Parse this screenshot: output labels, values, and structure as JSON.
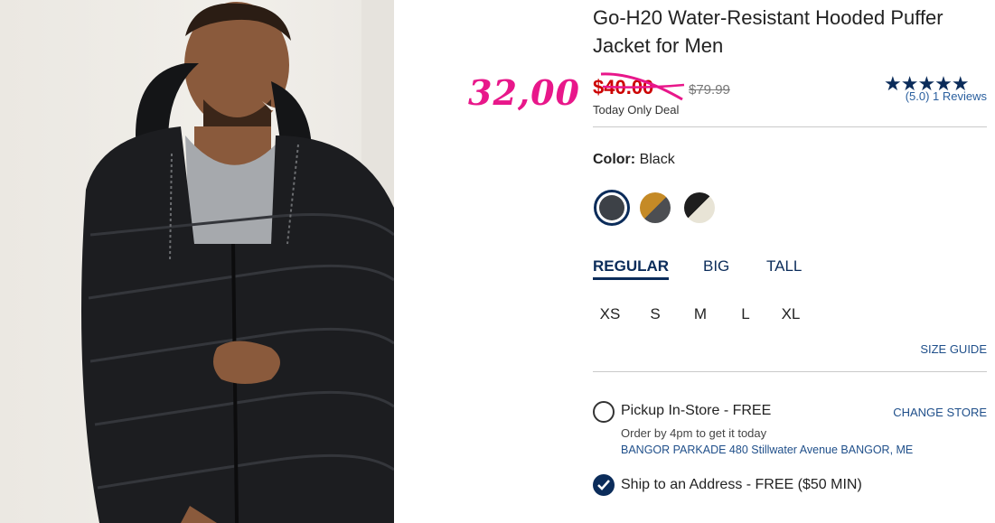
{
  "product": {
    "title": "Go-H20 Water-Resistant Hooded Puffer Jacket for Men",
    "image_alt": "Man wearing black hooded puffer jacket"
  },
  "pricing": {
    "handwritten_price": "32,00",
    "sale_price": "$40.00",
    "original_price": "$79.99",
    "deal_label": "Today Only Deal",
    "sale_color": "#cc0000",
    "annotation_color": "#e8178a"
  },
  "rating": {
    "stars": "★★★★★",
    "score": 5.0,
    "reviews_text": "(5.0) 1 Reviews"
  },
  "color": {
    "label": "Color:",
    "selected": "Black",
    "swatches": [
      "black-swatch",
      "mustard-charcoal-swatch",
      "black-cream-swatch"
    ]
  },
  "fit": {
    "tabs": [
      "REGULAR",
      "BIG",
      "TALL"
    ],
    "active": "REGULAR"
  },
  "sizes": [
    "XS",
    "S",
    "M",
    "L",
    "XL"
  ],
  "size_guide": "SIZE GUIDE",
  "fulfillment": {
    "pickup_label": "Pickup In-Store - FREE",
    "pickup_note": "Order by 4pm to get it today",
    "store_address": "BANGOR PARKADE 480 Stillwater Avenue  BANGOR, ME",
    "change_store": "CHANGE STORE",
    "ship_label": "Ship to an Address - FREE ($50 MIN)"
  },
  "colors": {
    "brand_navy": "#0b2c5a",
    "link_blue": "#1f4f8a"
  }
}
